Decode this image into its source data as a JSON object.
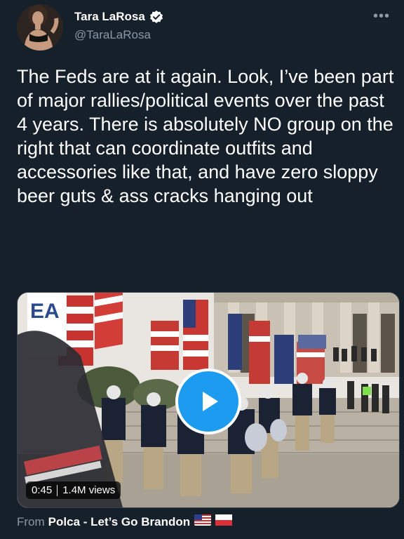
{
  "author": {
    "display_name": "Tara LaRosa",
    "handle": "@TaraLaRosa",
    "verified": true
  },
  "menu": {
    "more_label": "•••"
  },
  "tweet": {
    "text": "The Feds are at it again. Look, I’ve been part of major rallies/political events over the past 4 years. There is absolutely NO group on the right that can coordinate outfits and accessories like that, and have zero sloppy beer guts & ass cracks hanging out"
  },
  "media": {
    "duration": "0:45",
    "views": "1.4M views",
    "sign_text": "EA"
  },
  "source": {
    "prefix": "From",
    "app_name": "Polca - Let’s Go Brandon",
    "flags": [
      "us-flag-icon",
      "poland-flag-icon"
    ]
  },
  "colors": {
    "background": "#15202b",
    "accent": "#1d9bf0",
    "secondary_text": "#8b98a5",
    "primary_text": "#ffffff"
  }
}
